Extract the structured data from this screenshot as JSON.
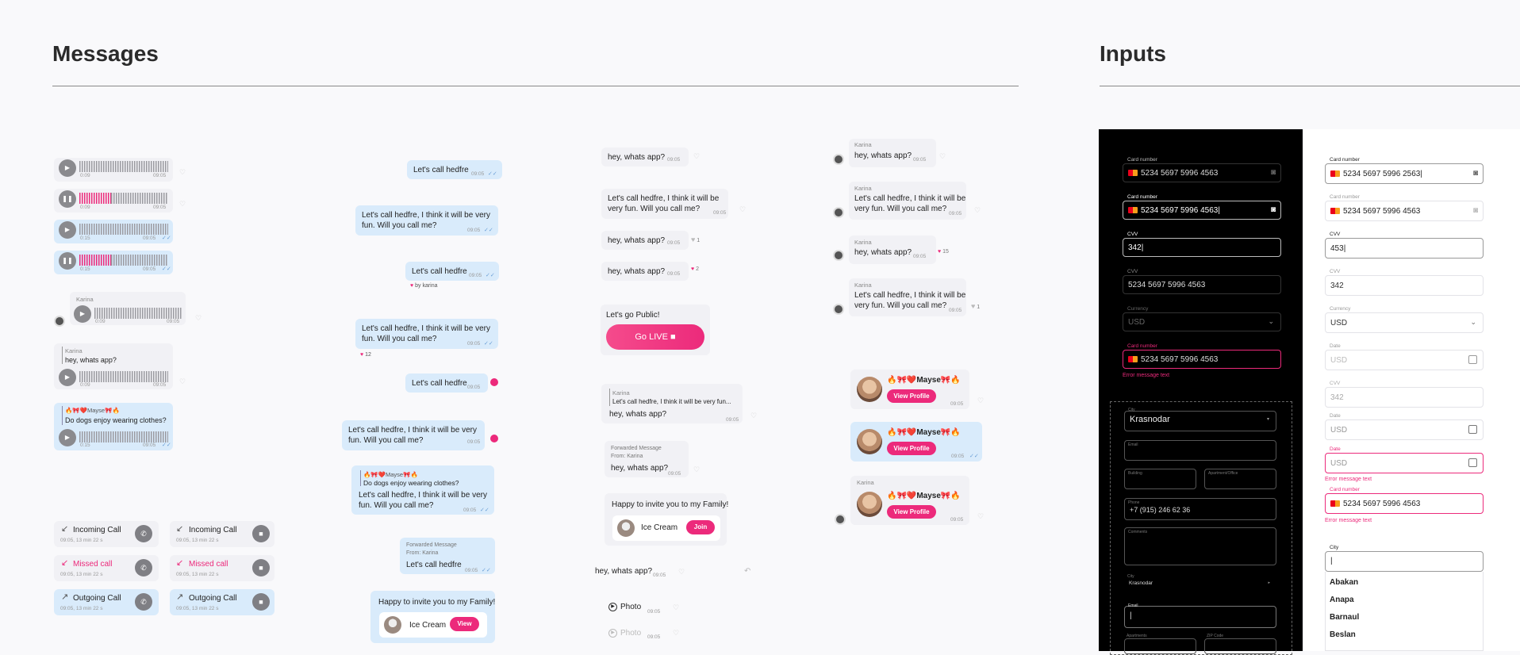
{
  "sections": {
    "messages": "Messages",
    "inputs": "Inputs"
  },
  "voice": {
    "t1": "0:09",
    "t2": "0:15",
    "time": "09:05",
    "sender": "Karina",
    "reply_text": "hey, whats app?",
    "fwd_name": "🔥🎀❤️Mayse🎀🔥",
    "fwd_text": "Do dogs enjoy wearing clothes?"
  },
  "calls": {
    "incoming": "Incoming Call",
    "missed": "Missed call",
    "outgoing": "Outgoing Call",
    "meta": "09:05, 13 min 22 s"
  },
  "col2": {
    "short": "Let's call hedfre",
    "long1": "Let's call hedfre, I think it will be very",
    "long2": "fun. Will you call me?",
    "by": "by karina",
    "count12": "12",
    "reply_name": "🔥🎀❤️Mayse🎀🔥",
    "reply_text": "Do dogs enjoy wearing clothes?",
    "fwd_label": "Forwarded Message",
    "fwd_from": "From: Karina",
    "invite": "Happy to invite you to my Family!",
    "family": "Ice Cream",
    "view": "View",
    "time": "09:05"
  },
  "col3": {
    "whats": "hey, whats app?",
    "long1": "Let's call hedfre, I think it will be",
    "long2": "very fun. Will you call me?",
    "c1": "1",
    "c2": "2",
    "golive_title": "Let's go Public!",
    "golive": "Go LIVE",
    "karina": "Karina",
    "quote": "Let's call hedfre, I think it will be very fun...",
    "fwd_label": "Forwarded Message",
    "fwd_from": "From: Karina",
    "invite": "Happy to invite you to my Family!",
    "family": "Ice Cream",
    "join": "Join",
    "photo": "Photo",
    "time": "09:05"
  },
  "col4": {
    "karina": "Karina",
    "whats": "hey, whats app?",
    "long1": "Let's call hedfre, I think it will be",
    "long2": "very fun. Will you call me?",
    "c15": "15",
    "c1": "1",
    "profile_name": "🔥🎀❤️Mayse🎀🔥",
    "view_profile": "View Profile",
    "time": "09:05"
  },
  "dark": {
    "card_label": "Card number",
    "card_value": "5234 5697 5996 4563",
    "cvv_label": "CVV",
    "cvv_value": "342",
    "currency_label": "Currency",
    "currency_value": "USD",
    "error": "Error message text",
    "city_label": "City",
    "city_value": "Krasnodar",
    "email_label": "Email",
    "building_label": "Building",
    "apt_label": "Apartment/Office",
    "phone_label": "Phone",
    "phone_value": "+7 (915) 246 62 36",
    "comments_label": "Comments",
    "zip_label": "ZIP Code",
    "apartment_label": "Apartments"
  },
  "light": {
    "card_label": "Card number",
    "card_value_active": "5234 5697 5996 2563",
    "card_value": "5234 5697 5996 4563",
    "cvv_label": "CVV",
    "cvv_active": "453",
    "cvv_value": "342",
    "currency_label": "Currency",
    "currency_value": "USD",
    "date_label": "Date",
    "date_value": "USD",
    "error": "Error message text",
    "city_label": "City",
    "cities": [
      "Abakan",
      "Anapa",
      "Barnaul",
      "Beslan"
    ]
  }
}
